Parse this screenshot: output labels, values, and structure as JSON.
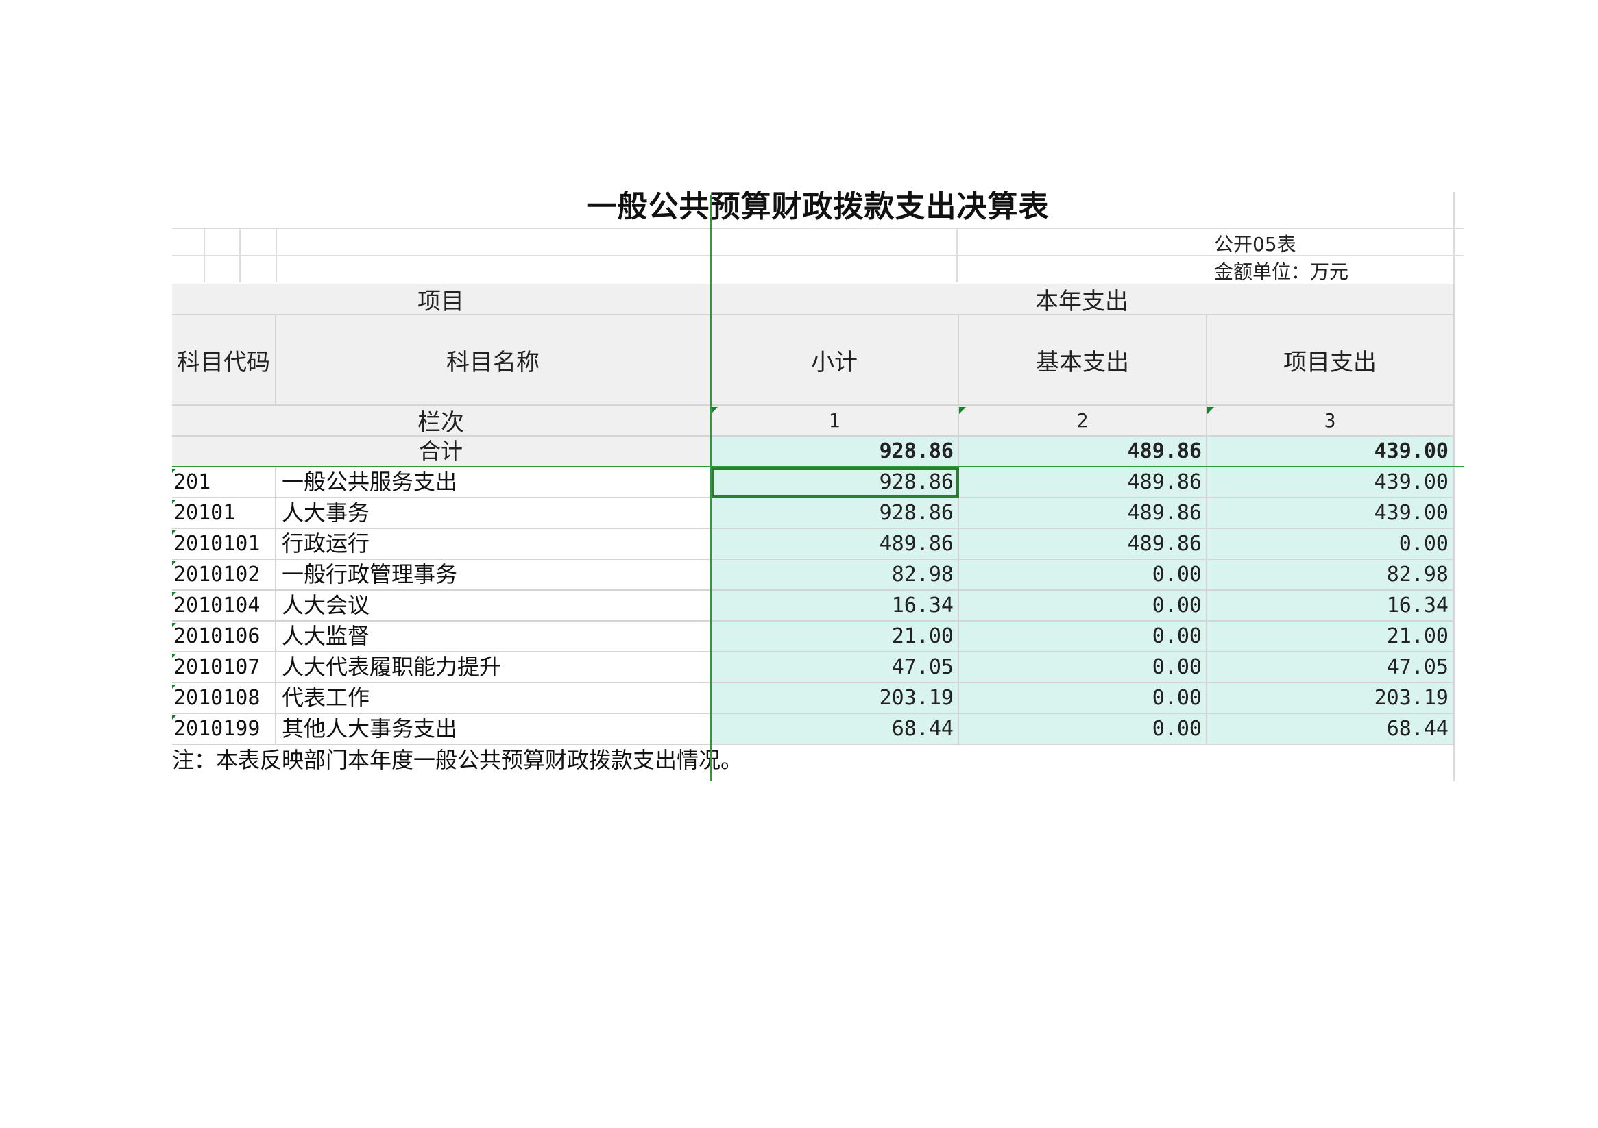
{
  "title": "一般公共预算财政拨款支出决算表",
  "form_code": "公开05表",
  "unit_label": "金额单位：万元",
  "header": {
    "project": "项目",
    "current_year_expense": "本年支出",
    "subject_code": "科目代码",
    "subject_name": "科目名称",
    "subtotal": "小计",
    "basic_expense": "基本支出",
    "project_expense": "项目支出",
    "column_index": "栏次",
    "col1": "1",
    "col2": "2",
    "col3": "3"
  },
  "total": {
    "label": "合计",
    "subtotal": "928.86",
    "basic": "489.86",
    "project": "439.00"
  },
  "rows": [
    {
      "code": "201",
      "name": "一般公共服务支出",
      "subtotal": "928.86",
      "basic": "489.86",
      "project": "439.00"
    },
    {
      "code": "20101",
      "name": "人大事务",
      "subtotal": "928.86",
      "basic": "489.86",
      "project": "439.00"
    },
    {
      "code": "2010101",
      "name": "行政运行",
      "subtotal": "489.86",
      "basic": "489.86",
      "project": "0.00"
    },
    {
      "code": "2010102",
      "name": "一般行政管理事务",
      "subtotal": "82.98",
      "basic": "0.00",
      "project": "82.98"
    },
    {
      "code": "2010104",
      "name": "人大会议",
      "subtotal": "16.34",
      "basic": "0.00",
      "project": "16.34"
    },
    {
      "code": "2010106",
      "name": "人大监督",
      "subtotal": "21.00",
      "basic": "0.00",
      "project": "21.00"
    },
    {
      "code": "2010107",
      "name": "人大代表履职能力提升",
      "subtotal": "47.05",
      "basic": "0.00",
      "project": "47.05"
    },
    {
      "code": "2010108",
      "name": "代表工作",
      "subtotal": "203.19",
      "basic": "0.00",
      "project": "203.19"
    },
    {
      "code": "2010199",
      "name": "其他人大事务支出",
      "subtotal": "68.44",
      "basic": "0.00",
      "project": "68.44"
    }
  ],
  "note": "注：本表反映部门本年度一般公共预算财政拨款支出情况。",
  "colors": {
    "header_bg": "#f0f0f0",
    "number_bg": "#d9f4ef",
    "selection": "#2e7d32"
  }
}
